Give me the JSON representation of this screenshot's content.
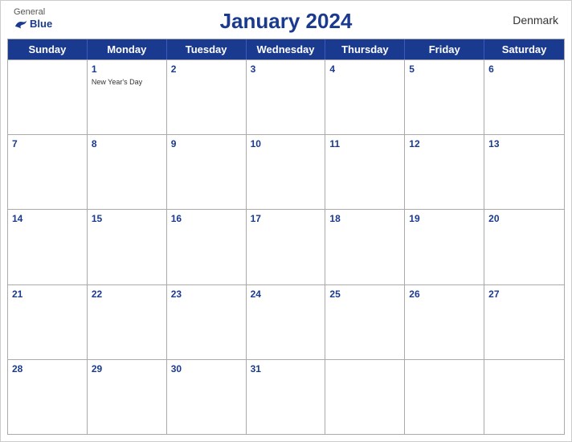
{
  "header": {
    "logo_general": "General",
    "logo_blue": "Blue",
    "title": "January 2024",
    "country": "Denmark"
  },
  "days_of_week": [
    "Sunday",
    "Monday",
    "Tuesday",
    "Wednesday",
    "Thursday",
    "Friday",
    "Saturday"
  ],
  "weeks": [
    [
      {
        "date": "",
        "holiday": ""
      },
      {
        "date": "1",
        "holiday": "New Year's Day"
      },
      {
        "date": "2",
        "holiday": ""
      },
      {
        "date": "3",
        "holiday": ""
      },
      {
        "date": "4",
        "holiday": ""
      },
      {
        "date": "5",
        "holiday": ""
      },
      {
        "date": "6",
        "holiday": ""
      }
    ],
    [
      {
        "date": "7",
        "holiday": ""
      },
      {
        "date": "8",
        "holiday": ""
      },
      {
        "date": "9",
        "holiday": ""
      },
      {
        "date": "10",
        "holiday": ""
      },
      {
        "date": "11",
        "holiday": ""
      },
      {
        "date": "12",
        "holiday": ""
      },
      {
        "date": "13",
        "holiday": ""
      }
    ],
    [
      {
        "date": "14",
        "holiday": ""
      },
      {
        "date": "15",
        "holiday": ""
      },
      {
        "date": "16",
        "holiday": ""
      },
      {
        "date": "17",
        "holiday": ""
      },
      {
        "date": "18",
        "holiday": ""
      },
      {
        "date": "19",
        "holiday": ""
      },
      {
        "date": "20",
        "holiday": ""
      }
    ],
    [
      {
        "date": "21",
        "holiday": ""
      },
      {
        "date": "22",
        "holiday": ""
      },
      {
        "date": "23",
        "holiday": ""
      },
      {
        "date": "24",
        "holiday": ""
      },
      {
        "date": "25",
        "holiday": ""
      },
      {
        "date": "26",
        "holiday": ""
      },
      {
        "date": "27",
        "holiday": ""
      }
    ],
    [
      {
        "date": "28",
        "holiday": ""
      },
      {
        "date": "29",
        "holiday": ""
      },
      {
        "date": "30",
        "holiday": ""
      },
      {
        "date": "31",
        "holiday": ""
      },
      {
        "date": "",
        "holiday": ""
      },
      {
        "date": "",
        "holiday": ""
      },
      {
        "date": "",
        "holiday": ""
      }
    ]
  ],
  "accent_color": "#1a3a8f"
}
